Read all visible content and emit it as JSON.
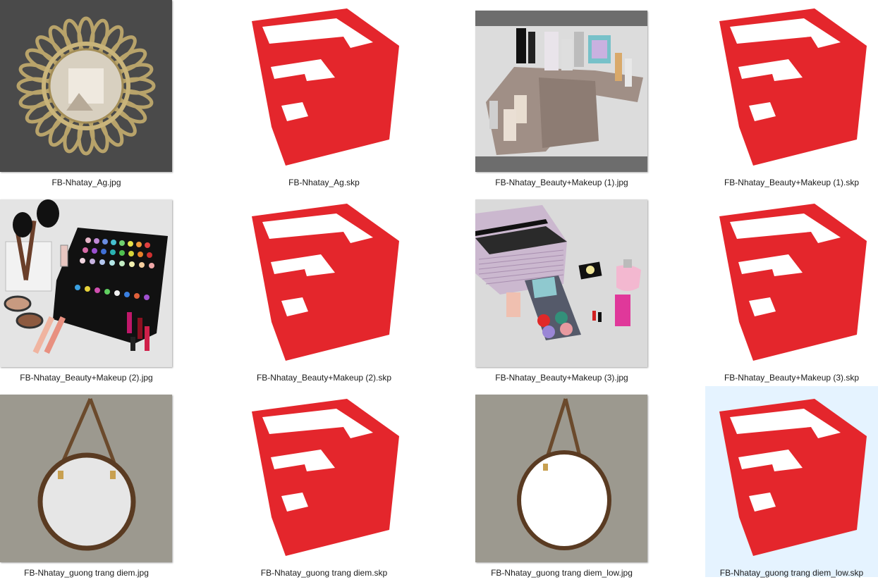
{
  "colors": {
    "sketchup_red": "#e4262c",
    "selection": "#e5f3ff",
    "mirror_bg_dark": "#4a4a4a",
    "mirror_bg_grey": "#9c998f",
    "photo_bg_light": "#dcdcdc"
  },
  "files": [
    {
      "name": "FB-Nhatay_Ag.jpg",
      "kind": "image",
      "icon": "sunburst-mirror-thumbnail"
    },
    {
      "name": "FB-Nhatay_Ag.skp",
      "kind": "sketchup",
      "icon": "sketchup-icon"
    },
    {
      "name": "FB-Nhatay_Beauty+Makeup (1).jpg",
      "kind": "image",
      "icon": "makeup-organizer-thumbnail"
    },
    {
      "name": "FB-Nhatay_Beauty+Makeup (1).skp",
      "kind": "sketchup",
      "icon": "sketchup-icon"
    },
    {
      "name": "FB-Nhatay_Beauty+Makeup (2).jpg",
      "kind": "image",
      "icon": "makeup-palette-thumbnail"
    },
    {
      "name": "FB-Nhatay_Beauty+Makeup (2).skp",
      "kind": "sketchup",
      "icon": "sketchup-icon"
    },
    {
      "name": "FB-Nhatay_Beauty+Makeup (3).jpg",
      "kind": "image",
      "icon": "makeup-bag-thumbnail"
    },
    {
      "name": "FB-Nhatay_Beauty+Makeup (3).skp",
      "kind": "sketchup",
      "icon": "sketchup-icon"
    },
    {
      "name": "FB-Nhatay_guong trang diem.jpg",
      "kind": "image",
      "icon": "round-mirror-thumbnail"
    },
    {
      "name": "FB-Nhatay_guong trang diem.skp",
      "kind": "sketchup",
      "icon": "sketchup-icon"
    },
    {
      "name": "FB-Nhatay_guong trang diem_low.jpg",
      "kind": "image",
      "icon": "round-mirror-low-thumbnail"
    },
    {
      "name": "FB-Nhatay_guong trang diem_low.skp",
      "kind": "sketchup",
      "icon": "sketchup-icon",
      "selected": true
    }
  ]
}
